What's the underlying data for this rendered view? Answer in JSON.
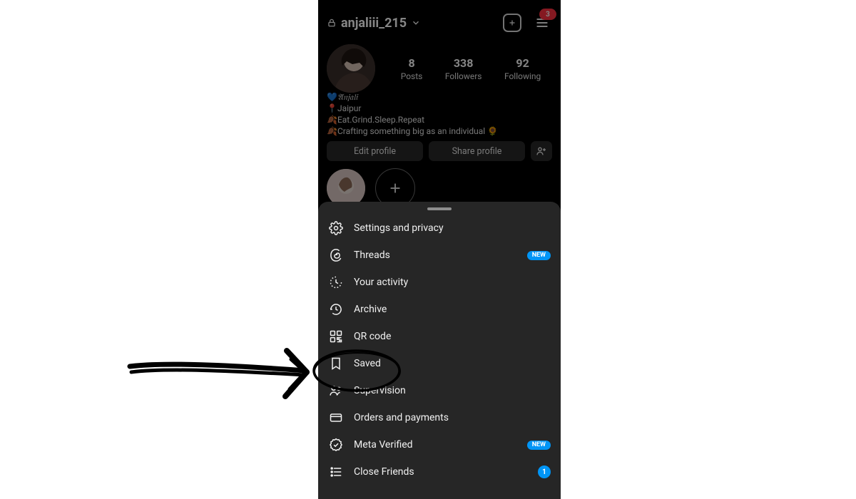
{
  "header": {
    "username": "anjaliii_215",
    "menu_badge": "3"
  },
  "stats": {
    "posts": {
      "count": "8",
      "label": "Posts"
    },
    "followers": {
      "count": "338",
      "label": "Followers"
    },
    "following": {
      "count": "92",
      "label": "Following"
    }
  },
  "bio": {
    "display_name": "𝔄𝔫𝔧𝔞𝔩𝔦",
    "location": "Jaipur",
    "line3": "Eat.Grind.Sleep.Repeat",
    "line4": "Crafting something big as an individual"
  },
  "buttons": {
    "edit": "Edit profile",
    "share": "Share profile"
  },
  "menu": [
    {
      "icon": "gear-icon",
      "label": "Settings and privacy"
    },
    {
      "icon": "threads-icon",
      "label": "Threads",
      "badge": "NEW"
    },
    {
      "icon": "activity-icon",
      "label": "Your activity"
    },
    {
      "icon": "archive-icon",
      "label": "Archive"
    },
    {
      "icon": "qr-icon",
      "label": "QR code"
    },
    {
      "icon": "bookmark-icon",
      "label": "Saved"
    },
    {
      "icon": "supervision-icon",
      "label": "Supervision"
    },
    {
      "icon": "card-icon",
      "label": "Orders and payments"
    },
    {
      "icon": "verified-icon",
      "label": "Meta Verified",
      "badge": "NEW"
    },
    {
      "icon": "list-icon",
      "label": "Close Friends",
      "badge": "1"
    }
  ],
  "annotation": {
    "target_menu_item": "Saved",
    "style": "hand-drawn arrow and circle"
  }
}
